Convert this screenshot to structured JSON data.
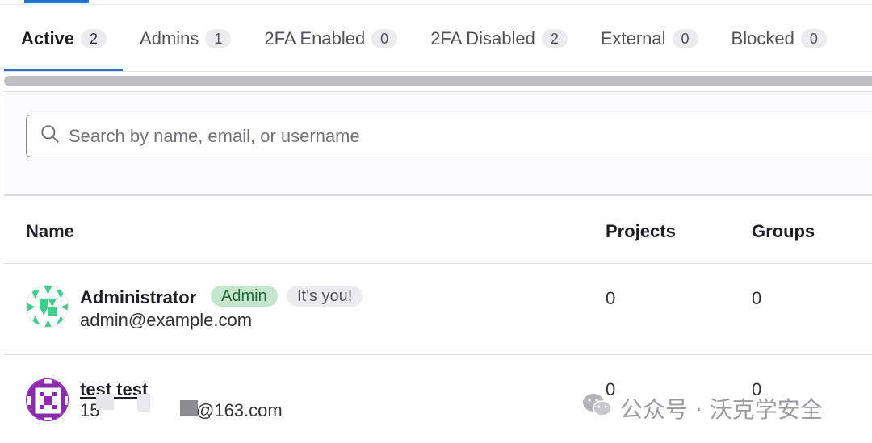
{
  "tabs": [
    {
      "label": "Active",
      "count": "2"
    },
    {
      "label": "Admins",
      "count": "1"
    },
    {
      "label": "2FA Enabled",
      "count": "0"
    },
    {
      "label": "2FA Disabled",
      "count": "2"
    },
    {
      "label": "External",
      "count": "0"
    },
    {
      "label": "Blocked",
      "count": "0"
    }
  ],
  "search": {
    "placeholder": "Search by name, email, or username",
    "icon": "search-icon"
  },
  "table": {
    "headers": {
      "name": "Name",
      "projects": "Projects",
      "groups": "Groups"
    },
    "rows": [
      {
        "name": "Administrator",
        "email": "admin@example.com",
        "badges": [
          "Admin",
          "It's you!"
        ],
        "projects": "0",
        "groups": "0",
        "avatar_color": "#3ecf8e"
      },
      {
        "name": "test test",
        "email_prefix": "15",
        "email_suffix": "@163.com",
        "projects": "0",
        "groups": "0",
        "avatar_color": "#8a2bb0"
      }
    ]
  },
  "watermark": {
    "text": "公众号 · 沃克学安全",
    "icon": "wechat-icon"
  },
  "colors": {
    "accent": "#1f75cb",
    "admin_badge_bg": "#c3e6cd",
    "admin_badge_text": "#24663b"
  }
}
